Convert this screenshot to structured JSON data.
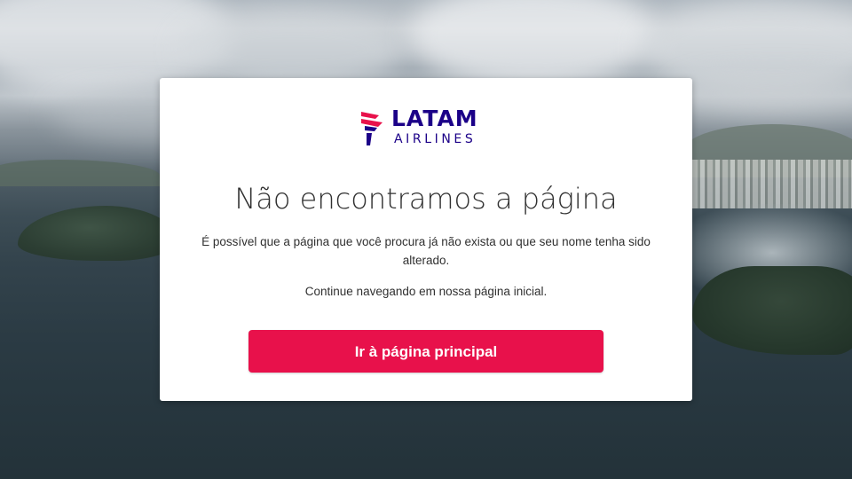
{
  "brand": {
    "name": "LATAM",
    "subname": "AIRLINES",
    "colors": {
      "primary": "#1b0088",
      "accent": "#e8114b"
    }
  },
  "error_page": {
    "title": "Não encontramos a página",
    "description": "É possível que a página que você procura já não exista ou que seu nome tenha sido alterado.",
    "hint": "Continue navegando em nossa página inicial.",
    "cta_label": "Ir à página principal"
  }
}
